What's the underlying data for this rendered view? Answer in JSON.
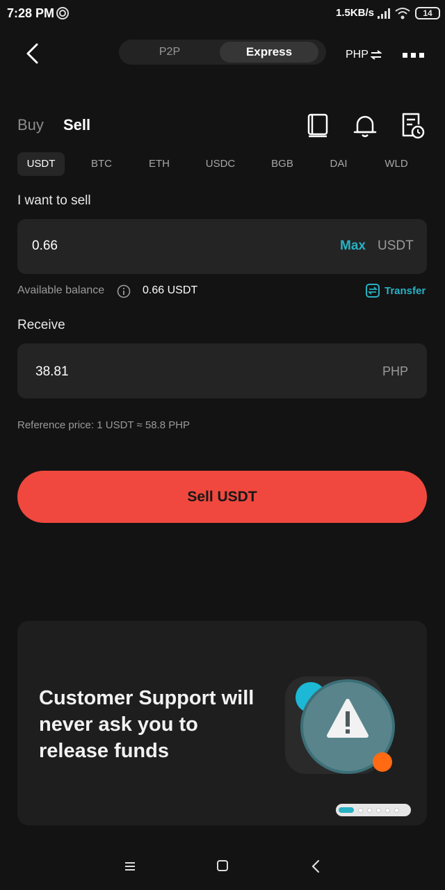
{
  "status_bar": {
    "time": "7:28 PM",
    "net_speed": "1.5KB/s",
    "battery": "14"
  },
  "header": {
    "modes": [
      "P2P",
      "Express"
    ],
    "active_mode": "Express",
    "currency": "PHP"
  },
  "trade_tabs": {
    "buy": "Buy",
    "sell": "Sell",
    "active": "Sell"
  },
  "coins": [
    "USDT",
    "BTC",
    "ETH",
    "USDC",
    "BGB",
    "DAI",
    "WLD"
  ],
  "active_coin": "USDT",
  "sell_section": {
    "label": "I want to sell",
    "amount": "0.66",
    "max_label": "Max",
    "unit": "USDT"
  },
  "balance": {
    "label": "Available balance",
    "value": "0.66 USDT",
    "transfer_label": "Transfer"
  },
  "receive_section": {
    "label": "Receive",
    "amount": "38.81",
    "unit": "PHP"
  },
  "reference_price": "Reference price: 1 USDT ≈ 58.8 PHP",
  "sell_button_label": "Sell USDT",
  "banner": {
    "text": "Customer Support will never ask you to release funds",
    "slide_count": 6,
    "active_slide": 1
  },
  "colors": {
    "accent": "#27b1c3",
    "sell_button": "#f0483e",
    "background": "#131313",
    "card": "#242424"
  }
}
